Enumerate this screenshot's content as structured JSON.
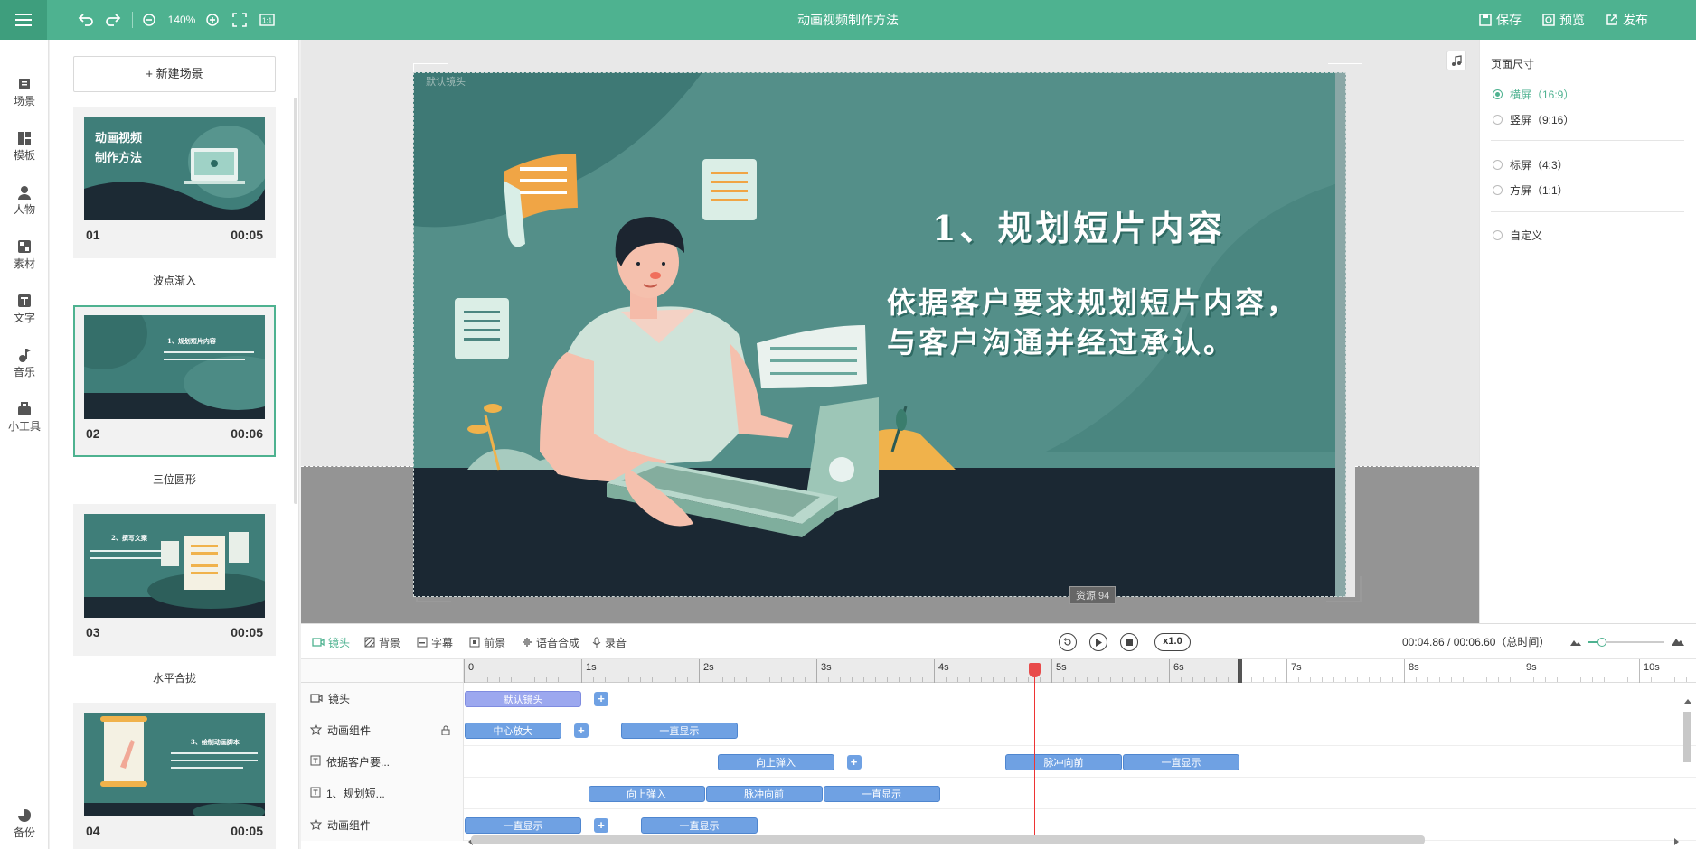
{
  "topbar": {
    "title": "动画视频制作方法",
    "zoom": "140%",
    "save": "保存",
    "preview": "预览",
    "publish": "发布",
    "aspect_btn": "1:1"
  },
  "nav": [
    {
      "label": "场景",
      "icon": "scene-icon"
    },
    {
      "label": "模板",
      "icon": "template-icon"
    },
    {
      "label": "人物",
      "icon": "person-icon"
    },
    {
      "label": "素材",
      "icon": "material-icon"
    },
    {
      "label": "文字",
      "icon": "text-icon"
    },
    {
      "label": "音乐",
      "icon": "music-icon"
    },
    {
      "label": "小工具",
      "icon": "tools-icon"
    },
    {
      "label": "备份",
      "icon": "backup-icon"
    }
  ],
  "scenes": {
    "new_scene": "+ 新建场景",
    "items": [
      {
        "num": "01",
        "dur": "00:05",
        "label": "波点渐入",
        "thumb_title": "动画视频\n制作方法"
      },
      {
        "num": "02",
        "dur": "00:06",
        "label": "三位圆形",
        "thumb_title": "1、规划短片内容"
      },
      {
        "num": "03",
        "dur": "00:05",
        "label": "水平合拢",
        "thumb_title": "2、撰写文案"
      },
      {
        "num": "04",
        "dur": "00:05",
        "label": "",
        "thumb_title": "3、绘制动画脚本"
      }
    ]
  },
  "canvas": {
    "camera_label": "默认镜头",
    "heading": "1、规划短片内容",
    "body_line1": "依据客户要求规划短片内容，",
    "body_line2": "与客户沟通并经过承认。",
    "asset_tag": "资源 94"
  },
  "right_panel": {
    "title": "页面尺寸",
    "options": [
      {
        "label": "横屏（16:9）",
        "selected": true
      },
      {
        "label": "竖屏（9:16）",
        "selected": false
      },
      {
        "label": "标屏（4:3）",
        "selected": false
      },
      {
        "label": "方屏（1:1）",
        "selected": false
      },
      {
        "label": "自定义",
        "selected": false
      }
    ]
  },
  "timeline_tabs": [
    "镜头",
    "背景",
    "字幕",
    "前景",
    "语音合成",
    "录音"
  ],
  "playback": {
    "speed": "x1.0",
    "time": "00:04.86 / 00:06.60（总时间）"
  },
  "ruler": [
    "0",
    "1s",
    "2s",
    "3s",
    "4s",
    "5s",
    "6s",
    "7s",
    "8s",
    "9s",
    "10s"
  ],
  "tracks": [
    {
      "label": "镜头",
      "icon": "camera-icon",
      "clips": [
        {
          "text": "默认镜头",
          "start": 0,
          "end": 1
        }
      ],
      "plus_at": 1.1
    },
    {
      "label": "动画组件",
      "icon": "star-icon",
      "lock": true,
      "clips": [
        {
          "text": "中心放大",
          "start": 0,
          "end": 0.83
        },
        {
          "text": "一直显示",
          "start": 1.33,
          "end": 2.33
        }
      ],
      "plus_at": 0.93
    },
    {
      "label": "依据客户要...",
      "icon": "text-track-icon",
      "clips": [
        {
          "text": "向上弹入",
          "start": 2.15,
          "end": 3.15
        },
        {
          "text": "脉冲向前",
          "start": 4.6,
          "end": 5.6
        },
        {
          "text": "一直显示",
          "start": 5.6,
          "end": 6.6
        }
      ],
      "plus_at": 3.25
    },
    {
      "label": "1、规划短...",
      "icon": "text-track-icon",
      "clips": [
        {
          "text": "向上弹入",
          "start": 1.05,
          "end": 2.05
        },
        {
          "text": "脉冲向前",
          "start": 2.05,
          "end": 3.05
        },
        {
          "text": "一直显示",
          "start": 3.05,
          "end": 4.05
        }
      ]
    },
    {
      "label": "动画组件",
      "icon": "star-icon",
      "clips": [
        {
          "text": "一直显示",
          "start": 0,
          "end": 1
        },
        {
          "text": "一直显示",
          "start": 1.5,
          "end": 2.5
        }
      ],
      "plus_at": 1.1
    }
  ],
  "colors": {
    "accent": "#4eb290",
    "clip": "#6fa1e3",
    "playhead": "#e33333"
  }
}
